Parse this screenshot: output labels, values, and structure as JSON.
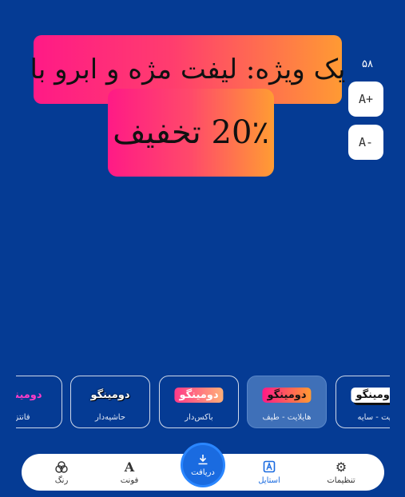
{
  "canvas": {
    "line1": "یک ویژه: لیفت مژه و ابرو با",
    "line2": "20٪ تخفیف"
  },
  "font_size": {
    "value": "۵۸",
    "increase_label": "A+",
    "decrease_label": "A-"
  },
  "styles": [
    {
      "preview": "دومینگو",
      "caption": "ایت - سایه"
    },
    {
      "preview": "دومینگو",
      "caption": "هایلایت - طیف"
    },
    {
      "preview": "دومینگو",
      "caption": "باکس‌دار"
    },
    {
      "preview": "دومینگو",
      "caption": "حاشیه‌دار"
    },
    {
      "preview": "دومینگو",
      "caption": "فانتز"
    }
  ],
  "nav": {
    "settings": "تنظیمات",
    "style": "استایل",
    "download": "دریافت",
    "font": "فونت",
    "color": "رنگ"
  },
  "icons": {
    "settings": "gear-icon",
    "style": "style-icon",
    "download": "download-icon",
    "font": "font-icon",
    "color": "palette-icon"
  },
  "colors": {
    "background": "#053b94",
    "accent": "#1a6be0",
    "gradient_start": "#ff1a86",
    "gradient_end": "#ff9a33"
  }
}
